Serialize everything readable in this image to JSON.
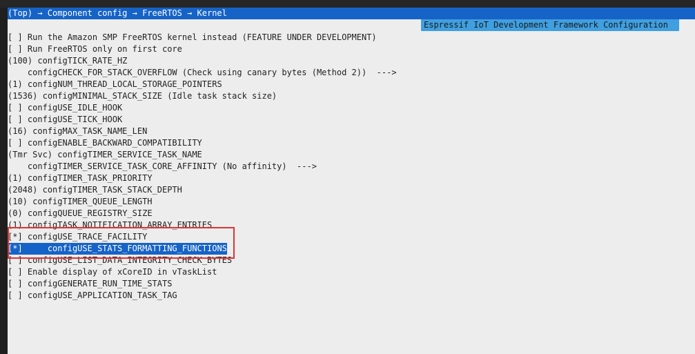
{
  "breadcrumb": "(Top) → Component config → FreeRTOS → Kernel",
  "subtitle": "Espressif IoT Development Framework Configuration",
  "menu": {
    "items": [
      {
        "prefix": "[ ]",
        "label": "Run the Amazon SMP FreeRTOS kernel instead (FEATURE UNDER DEVELOPMENT)"
      },
      {
        "prefix": "[ ]",
        "label": "Run FreeRTOS only on first core"
      },
      {
        "prefix": "(100)",
        "label": "configTICK_RATE_HZ"
      },
      {
        "prefix": "   ",
        "label": "configCHECK_FOR_STACK_OVERFLOW (Check using canary bytes (Method 2))  --->"
      },
      {
        "prefix": "(1)",
        "label": "configNUM_THREAD_LOCAL_STORAGE_POINTERS"
      },
      {
        "prefix": "(1536)",
        "label": "configMINIMAL_STACK_SIZE (Idle task stack size)"
      },
      {
        "prefix": "[ ]",
        "label": "configUSE_IDLE_HOOK"
      },
      {
        "prefix": "[ ]",
        "label": "configUSE_TICK_HOOK"
      },
      {
        "prefix": "(16)",
        "label": "configMAX_TASK_NAME_LEN"
      },
      {
        "prefix": "[ ]",
        "label": "configENABLE_BACKWARD_COMPATIBILITY"
      },
      {
        "prefix": "(Tmr Svc)",
        "label": "configTIMER_SERVICE_TASK_NAME"
      },
      {
        "prefix": "   ",
        "label": "configTIMER_SERVICE_TASK_CORE_AFFINITY (No affinity)  --->"
      },
      {
        "prefix": "(1)",
        "label": "configTIMER_TASK_PRIORITY"
      },
      {
        "prefix": "(2048)",
        "label": "configTIMER_TASK_STACK_DEPTH"
      },
      {
        "prefix": "(10)",
        "label": "configTIMER_QUEUE_LENGTH"
      },
      {
        "prefix": "(0)",
        "label": "configQUEUE_REGISTRY_SIZE"
      },
      {
        "prefix": "(1)",
        "label": "configTASK_NOTIFICATION_ARRAY_ENTRIES"
      },
      {
        "prefix": "[*]",
        "label": "configUSE_TRACE_FACILITY"
      },
      {
        "prefix": "[*]",
        "label": "    configUSE_STATS_FORMATTING_FUNCTIONS",
        "selected": true
      },
      {
        "prefix": "[ ]",
        "label": "configUSE_LIST_DATA_INTEGRITY_CHECK_BYTES"
      },
      {
        "prefix": "[ ]",
        "label": "Enable display of xCoreID in vTaskList"
      },
      {
        "prefix": "[ ]",
        "label": "configGENERATE_RUN_TIME_STATS"
      },
      {
        "prefix": "[ ]",
        "label": "configUSE_APPLICATION_TASK_TAG"
      }
    ]
  },
  "colors": {
    "breadcrumb_bg": "#1663c7",
    "subtitle_bg": "#3f9fe0",
    "terminal_bg": "#ededed",
    "selection_bg": "#1663c7",
    "highlight_border": "#e03232"
  }
}
